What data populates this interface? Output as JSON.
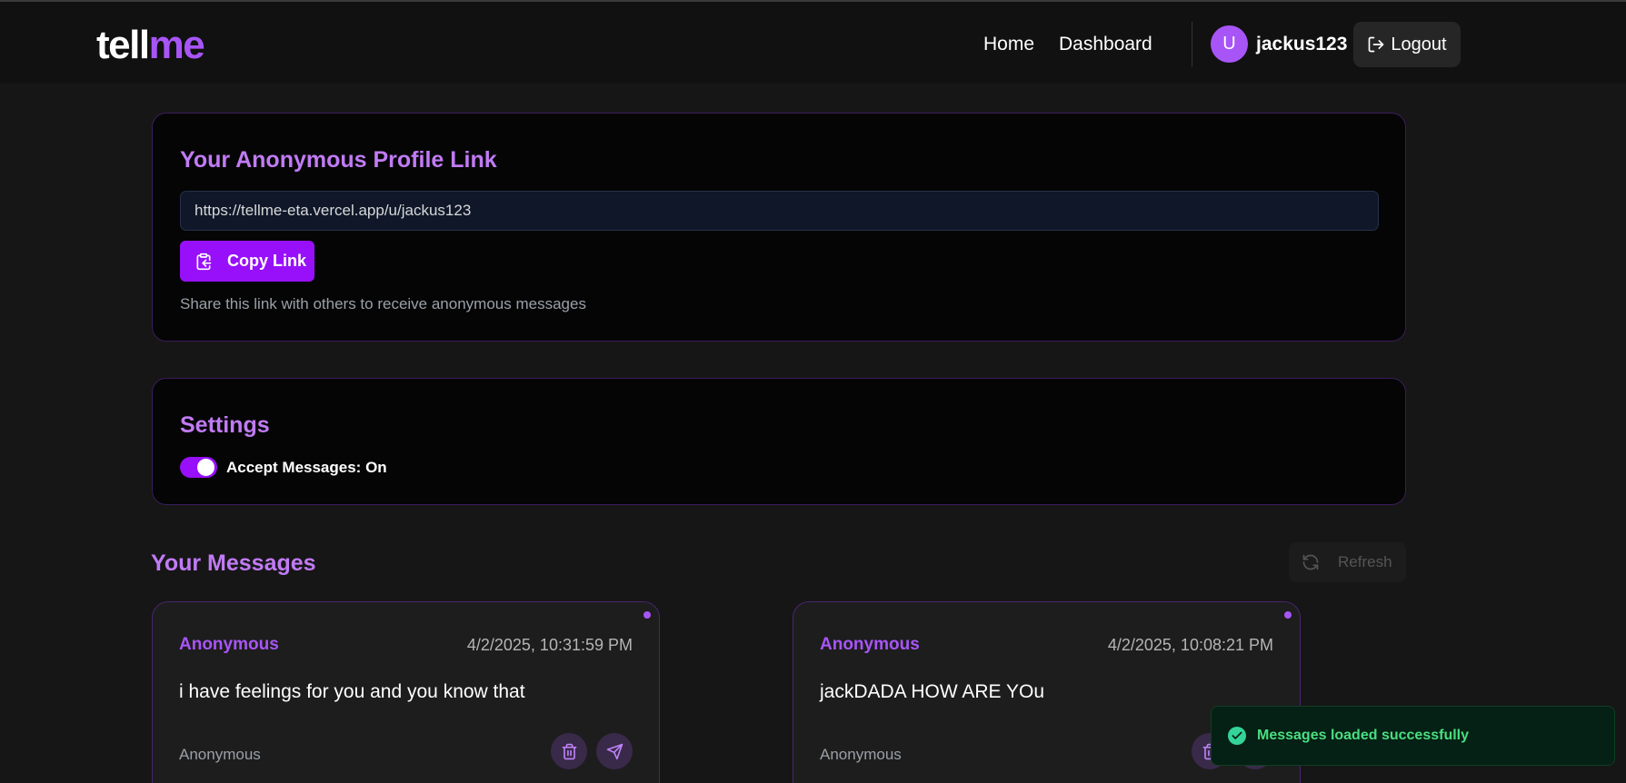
{
  "brand": {
    "part1": "tell",
    "part2": "me",
    "accent": "#a855f7"
  },
  "nav": {
    "home": "Home",
    "dashboard": "Dashboard",
    "avatar_initial": "U",
    "username": "jackus123",
    "logout": "Logout",
    "logout_icon": "logout-icon"
  },
  "profile_link": {
    "title": "Your Anonymous Profile Link",
    "url": "https://tellme-eta.vercel.app/u/jackus123",
    "copy_label": "Copy Link",
    "copy_icon": "clipboard-copy-icon",
    "hint": "Share this link with others to receive anonymous messages"
  },
  "settings": {
    "title": "Settings",
    "accept_messages_label": "Accept Messages: On",
    "accept_messages": true
  },
  "messages": {
    "title": "Your Messages",
    "refresh_label": "Refresh",
    "refresh_icon": "refresh-icon",
    "items": [
      {
        "sender": "Anonymous",
        "time": "4/2/2025, 10:31:59 PM",
        "text": "i have feelings for you and you know that",
        "footer": "Anonymous"
      },
      {
        "sender": "Anonymous",
        "time": "4/2/2025, 10:08:21 PM",
        "text": "jackDADA HOW ARE YOu",
        "footer": "Anonymous"
      }
    ]
  },
  "toast": {
    "text": "Messages loaded successfully",
    "icon": "check-circle-icon",
    "color": "#4ade80"
  }
}
